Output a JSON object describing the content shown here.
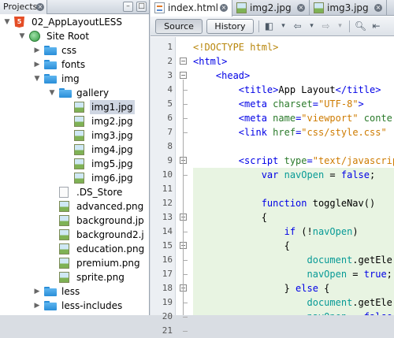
{
  "projects_panel": {
    "tab_label": "Projects",
    "tree": [
      {
        "label": "02_AppLayoutLESS",
        "icon": "html5-project-icon",
        "indent": 0,
        "expanded": true
      },
      {
        "label": "Site Root",
        "icon": "globe-icon",
        "indent": 1,
        "expanded": true
      },
      {
        "label": "css",
        "icon": "folder-icon",
        "indent": 2,
        "expanded": false
      },
      {
        "label": "fonts",
        "icon": "folder-icon",
        "indent": 2,
        "expanded": false
      },
      {
        "label": "img",
        "icon": "folder-icon",
        "indent": 2,
        "expanded": true
      },
      {
        "label": "gallery",
        "icon": "folder-icon",
        "indent": 3,
        "expanded": true
      },
      {
        "label": "img1.jpg",
        "icon": "image-file-icon",
        "indent": 4,
        "selected": true
      },
      {
        "label": "img2.jpg",
        "icon": "image-file-icon",
        "indent": 4
      },
      {
        "label": "img3.jpg",
        "icon": "image-file-icon",
        "indent": 4
      },
      {
        "label": "img4.jpg",
        "icon": "image-file-icon",
        "indent": 4
      },
      {
        "label": "img5.jpg",
        "icon": "image-file-icon",
        "indent": 4
      },
      {
        "label": "img6.jpg",
        "icon": "image-file-icon",
        "indent": 4
      },
      {
        "label": ".DS_Store",
        "icon": "text-file-icon",
        "indent": 3
      },
      {
        "label": "advanced.png",
        "icon": "image-file-icon",
        "indent": 3
      },
      {
        "label": "background.jp",
        "icon": "image-file-icon",
        "indent": 3
      },
      {
        "label": "background2.j",
        "icon": "image-file-icon",
        "indent": 3
      },
      {
        "label": "education.png",
        "icon": "image-file-icon",
        "indent": 3
      },
      {
        "label": "premium.png",
        "icon": "image-file-icon",
        "indent": 3
      },
      {
        "label": "sprite.png",
        "icon": "image-file-icon",
        "indent": 3
      },
      {
        "label": "less",
        "icon": "folder-icon",
        "indent": 2,
        "expanded": false
      },
      {
        "label": "less-includes",
        "icon": "folder-icon",
        "indent": 2,
        "expanded": false
      }
    ]
  },
  "editor": {
    "tabs": [
      {
        "label": "index.html",
        "icon": "html-file-icon",
        "active": true
      },
      {
        "label": "img2.jpg",
        "icon": "image-file-icon",
        "active": false
      },
      {
        "label": "img3.jpg",
        "icon": "image-file-icon",
        "active": false
      }
    ],
    "toolbar": {
      "source_label": "Source",
      "history_label": "History"
    },
    "lines": [
      {
        "n": "1",
        "tokens": [
          [
            "doc",
            "<!DOCTYPE html>"
          ]
        ]
      },
      {
        "n": "2",
        "tokens": [
          [
            "tag",
            "<html>"
          ]
        ]
      },
      {
        "n": "3",
        "tokens": [
          [
            "txt",
            "    "
          ],
          [
            "tag",
            "<head>"
          ]
        ]
      },
      {
        "n": "4",
        "tokens": [
          [
            "txt",
            "        "
          ],
          [
            "tag",
            "<title>"
          ],
          [
            "txt",
            "App Layout"
          ],
          [
            "tag",
            "</title>"
          ]
        ]
      },
      {
        "n": "5",
        "tokens": [
          [
            "txt",
            "        "
          ],
          [
            "tag",
            "<meta "
          ],
          [
            "attr",
            "charset"
          ],
          [
            "tag",
            "="
          ],
          [
            "str",
            "\"UTF-8\""
          ],
          [
            "tag",
            ">"
          ]
        ]
      },
      {
        "n": "6",
        "tokens": [
          [
            "txt",
            "        "
          ],
          [
            "tag",
            "<meta "
          ],
          [
            "attr",
            "name"
          ],
          [
            "tag",
            "="
          ],
          [
            "str",
            "\"viewport\""
          ],
          [
            "txt",
            " "
          ],
          [
            "attr",
            "conte"
          ]
        ]
      },
      {
        "n": "7",
        "tokens": [
          [
            "txt",
            "        "
          ],
          [
            "tag",
            "<link "
          ],
          [
            "attr",
            "href"
          ],
          [
            "tag",
            "="
          ],
          [
            "str",
            "\"css/style.css\""
          ]
        ]
      },
      {
        "n": "8",
        "tokens": []
      },
      {
        "n": "9",
        "tokens": [
          [
            "txt",
            "        "
          ],
          [
            "tag",
            "<script "
          ],
          [
            "attr",
            "type"
          ],
          [
            "tag",
            "="
          ],
          [
            "str",
            "\"text/javascrip"
          ]
        ]
      },
      {
        "n": "10",
        "tokens": [
          [
            "txt",
            "            "
          ],
          [
            "kw",
            "var "
          ],
          [
            "id",
            "navOpen"
          ],
          [
            "txt",
            " = "
          ],
          [
            "kw",
            "false"
          ],
          [
            "txt",
            ";"
          ]
        ]
      },
      {
        "n": "11",
        "tokens": []
      },
      {
        "n": "12",
        "tokens": [
          [
            "txt",
            "            "
          ],
          [
            "kw",
            "function "
          ],
          [
            "txt",
            "toggleNav()"
          ]
        ]
      },
      {
        "n": "13",
        "tokens": [
          [
            "txt",
            "            {"
          ]
        ]
      },
      {
        "n": "14",
        "tokens": [
          [
            "txt",
            "                "
          ],
          [
            "kw",
            "if "
          ],
          [
            "txt",
            "(!"
          ],
          [
            "id",
            "navOpen"
          ],
          [
            "txt",
            ")"
          ]
        ]
      },
      {
        "n": "15",
        "tokens": [
          [
            "txt",
            "                {"
          ]
        ]
      },
      {
        "n": "16",
        "tokens": [
          [
            "txt",
            "                    "
          ],
          [
            "id",
            "document"
          ],
          [
            "txt",
            ".getEle"
          ]
        ]
      },
      {
        "n": "17",
        "tokens": [
          [
            "txt",
            "                    "
          ],
          [
            "id",
            "navOpen"
          ],
          [
            "txt",
            " = "
          ],
          [
            "kw",
            "true"
          ],
          [
            "txt",
            ";"
          ]
        ]
      },
      {
        "n": "18",
        "tokens": [
          [
            "txt",
            "                } "
          ],
          [
            "kw",
            "else "
          ],
          [
            "txt",
            "{"
          ]
        ]
      },
      {
        "n": "19",
        "tokens": [
          [
            "txt",
            "                    "
          ],
          [
            "id",
            "document"
          ],
          [
            "txt",
            ".getEle"
          ]
        ]
      },
      {
        "n": "20",
        "tokens": [
          [
            "txt",
            "                    "
          ],
          [
            "id",
            "navOpen"
          ],
          [
            "txt",
            " = "
          ],
          [
            "kw",
            "false"
          ]
        ]
      },
      {
        "n": "21",
        "tokens": [
          [
            "txt",
            "                }"
          ]
        ]
      }
    ],
    "highlight_color": "#e8f4e2"
  }
}
